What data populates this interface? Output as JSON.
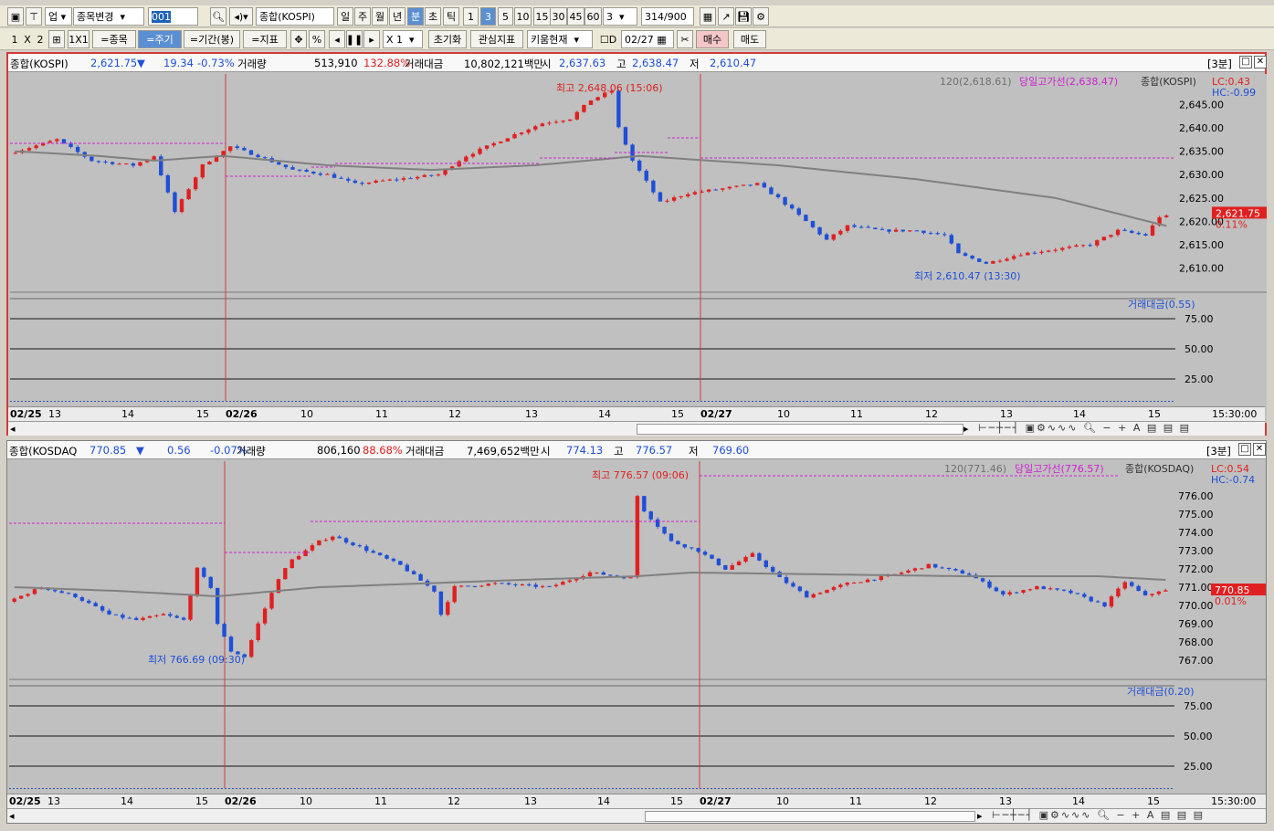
{
  "toolbar1": {
    "upjong": "업",
    "symbol_change": "종목변경",
    "code": "001",
    "name": "종합(KOSPI)",
    "periods": [
      "일",
      "주",
      "월",
      "년",
      "분",
      "초",
      "틱"
    ],
    "intervals": [
      "1",
      "3",
      "5",
      "10",
      "15",
      "30",
      "45",
      "60"
    ],
    "interval_value": "3",
    "count_value": "314",
    "count_total": "/900"
  },
  "toolbar2": {
    "layout": [
      "1",
      "X",
      "2"
    ],
    "one": "1X1",
    "btn_symbol": "=종목",
    "btn_period": "=주기",
    "btn_range": "=기간(봉)",
    "btn_indicator": "=지표",
    "pct": "%",
    "zoom": "X 1",
    "reset": "초기화",
    "watch": "관심지표",
    "kiwoom": "키움현재",
    "d_label": "D",
    "date": "02/27",
    "buy": "매수",
    "sell": "매도"
  },
  "panels": [
    {
      "name": "종합(KOSPI)",
      "price": "2,621.75",
      "arrow": "▼",
      "change": "19.34",
      "rate": "-0.73%",
      "vol_label": "거래량",
      "volume": "513,910",
      "vol_rate": "132.88%",
      "amt_label": "거래대금",
      "amount": "10,802,121백만",
      "open_l": "시",
      "open": "2,637.63",
      "high_l": "고",
      "high": "2,638.47",
      "low_l": "저",
      "low": "2,610.47",
      "tf": "[3분]",
      "ma_legend": "120(2,618.61)",
      "hiline": "당일고가선(2,638.47)",
      "series": "종합(KOSPI)",
      "lc": "LC:0.43",
      "hc": "HC:-0.99",
      "max_note": "최고 2,648.06 (15:06)",
      "min_note": "최저 2,610.47 (13:30)",
      "last_tag": "2,621.75",
      "pct_tag": "0.11%",
      "yticks": [
        "2,645.00",
        "2,640.00",
        "2,635.00",
        "2,630.00",
        "2,625.00",
        "2,620.00",
        "2,615.00",
        "2,610.00"
      ],
      "amt_legend": "거래대금(0.55)",
      "ind_ticks": [
        "75.00",
        "50.00",
        "25.00"
      ],
      "xlabels": [
        "02/25",
        "13",
        "14",
        "15",
        "02/26",
        "10",
        "11",
        "12",
        "13",
        "14",
        "15",
        "02/27",
        "10",
        "11",
        "12",
        "13",
        "14",
        "15"
      ],
      "time": "15:30:00"
    },
    {
      "name": "종합(KOSDAQ",
      "price": "770.85",
      "arrow": "▼",
      "change": "0.56",
      "rate": "-0.07%",
      "vol_label": "거래량",
      "volume": "806,160",
      "vol_rate": "88.68%",
      "amt_label": "거래대금",
      "amount": "7,469,652백만",
      "open_l": "시",
      "open": "774.13",
      "high_l": "고",
      "high": "776.57",
      "low_l": "저",
      "low": "769.60",
      "tf": "[3분]",
      "ma_legend": "120(771.46)",
      "hiline": "당일고가선(776.57)",
      "series": "종합(KOSDAQ)",
      "lc": "LC:0.54",
      "hc": "HC:-0.74",
      "max_note": "최고 776.57 (09:06)",
      "min_note": "최저 766.69 (09:30)",
      "last_tag": "770.85",
      "pct_tag": "0.01%",
      "yticks": [
        "776.00",
        "775.00",
        "774.00",
        "773.00",
        "772.00",
        "771.00",
        "770.00",
        "769.00",
        "768.00",
        "767.00"
      ],
      "amt_legend": "거래대금(0.20)",
      "ind_ticks": [
        "75.00",
        "50.00",
        "25.00"
      ],
      "xlabels": [
        "02/25",
        "13",
        "14",
        "15",
        "02/26",
        "10",
        "11",
        "12",
        "13",
        "14",
        "15",
        "02/27",
        "10",
        "11",
        "12",
        "13",
        "14",
        "15"
      ],
      "time": "15:30:00"
    }
  ],
  "colors": {
    "up": "#e02020",
    "down": "#1f4fd6",
    "ma": "#808080",
    "hiline": "#d020d0",
    "bg": "#c0c0c0"
  },
  "chart_data": [
    {
      "type": "candlestick",
      "title": "종합(KOSPI)",
      "timeframe": "3분",
      "ylim": [
        2605,
        2650
      ],
      "trend": [
        [
          0,
          2634.5
        ],
        [
          7,
          2637.5
        ],
        [
          12,
          2633
        ],
        [
          18,
          2632
        ],
        [
          21,
          2634
        ],
        [
          24,
          2622
        ],
        [
          28,
          2632
        ],
        [
          32,
          2636
        ],
        [
          36,
          2634
        ],
        [
          41,
          2631
        ],
        [
          46,
          2630
        ],
        [
          50,
          2628
        ],
        [
          56,
          2629
        ],
        [
          62,
          2630
        ],
        [
          66,
          2634
        ],
        [
          72,
          2638
        ],
        [
          77,
          2641
        ],
        [
          81,
          2642
        ],
        [
          84,
          2646
        ],
        [
          87,
          2648
        ],
        [
          88,
          2640
        ],
        [
          90,
          2633
        ],
        [
          94,
          2624
        ],
        [
          98,
          2626
        ],
        [
          103,
          2627
        ],
        [
          108,
          2628
        ],
        [
          111,
          2625
        ],
        [
          115,
          2620
        ],
        [
          118,
          2616
        ],
        [
          121,
          2619
        ],
        [
          126,
          2618
        ],
        [
          131,
          2618
        ],
        [
          135,
          2617
        ],
        [
          137,
          2613
        ],
        [
          141,
          2611
        ],
        [
          146,
          2613
        ],
        [
          151,
          2614
        ],
        [
          156,
          2615
        ],
        [
          160,
          2618
        ],
        [
          164,
          2617
        ],
        [
          166,
          2621
        ]
      ],
      "ma120": [
        [
          0,
          2635
        ],
        [
          12,
          2634
        ],
        [
          20,
          2633
        ],
        [
          30,
          2634
        ],
        [
          45,
          2632
        ],
        [
          60,
          2631
        ],
        [
          75,
          2632
        ],
        [
          90,
          2634
        ],
        [
          110,
          2632
        ],
        [
          130,
          2629
        ],
        [
          150,
          2625
        ],
        [
          166,
          2619
        ]
      ]
    },
    {
      "type": "candlestick",
      "title": "종합(KOSDAQ)",
      "timeframe": "3분",
      "ylim": [
        766,
        777.5
      ],
      "trend": [
        [
          0,
          770.2
        ],
        [
          5,
          771
        ],
        [
          10,
          770.5
        ],
        [
          15,
          769.5
        ],
        [
          19,
          769.2
        ],
        [
          23,
          769.5
        ],
        [
          26,
          769.2
        ],
        [
          28,
          772
        ],
        [
          30,
          771
        ],
        [
          31,
          769
        ],
        [
          33,
          767.5
        ],
        [
          35,
          767.2
        ],
        [
          37,
          769
        ],
        [
          40,
          771.5
        ],
        [
          42,
          772.5
        ],
        [
          46,
          773.5
        ],
        [
          48,
          773.8
        ],
        [
          52,
          773.2
        ],
        [
          58,
          772.2
        ],
        [
          63,
          770.8
        ],
        [
          64,
          769.5
        ],
        [
          66,
          771
        ],
        [
          72,
          771.2
        ],
        [
          80,
          771
        ],
        [
          86,
          771.8
        ],
        [
          92,
          771.5
        ],
        [
          93,
          776
        ],
        [
          94,
          775.2
        ],
        [
          98,
          773.5
        ],
        [
          102,
          773
        ],
        [
          106,
          772
        ],
        [
          110,
          772.8
        ],
        [
          114,
          771.5
        ],
        [
          118,
          770.5
        ],
        [
          124,
          771.2
        ],
        [
          130,
          771.6
        ],
        [
          136,
          772.2
        ],
        [
          142,
          771.7
        ],
        [
          147,
          770.6
        ],
        [
          152,
          771
        ],
        [
          157,
          770.7
        ],
        [
          162,
          770
        ],
        [
          165,
          771.3
        ],
        [
          168,
          770.5
        ],
        [
          170,
          770.8
        ]
      ],
      "ma120": [
        [
          0,
          771
        ],
        [
          15,
          770.8
        ],
        [
          30,
          770.5
        ],
        [
          45,
          771
        ],
        [
          60,
          771.2
        ],
        [
          75,
          771.4
        ],
        [
          92,
          771.6
        ],
        [
          100,
          771.8
        ],
        [
          120,
          771.7
        ],
        [
          140,
          771.6
        ],
        [
          160,
          771.6
        ],
        [
          170,
          771.4
        ]
      ]
    }
  ]
}
